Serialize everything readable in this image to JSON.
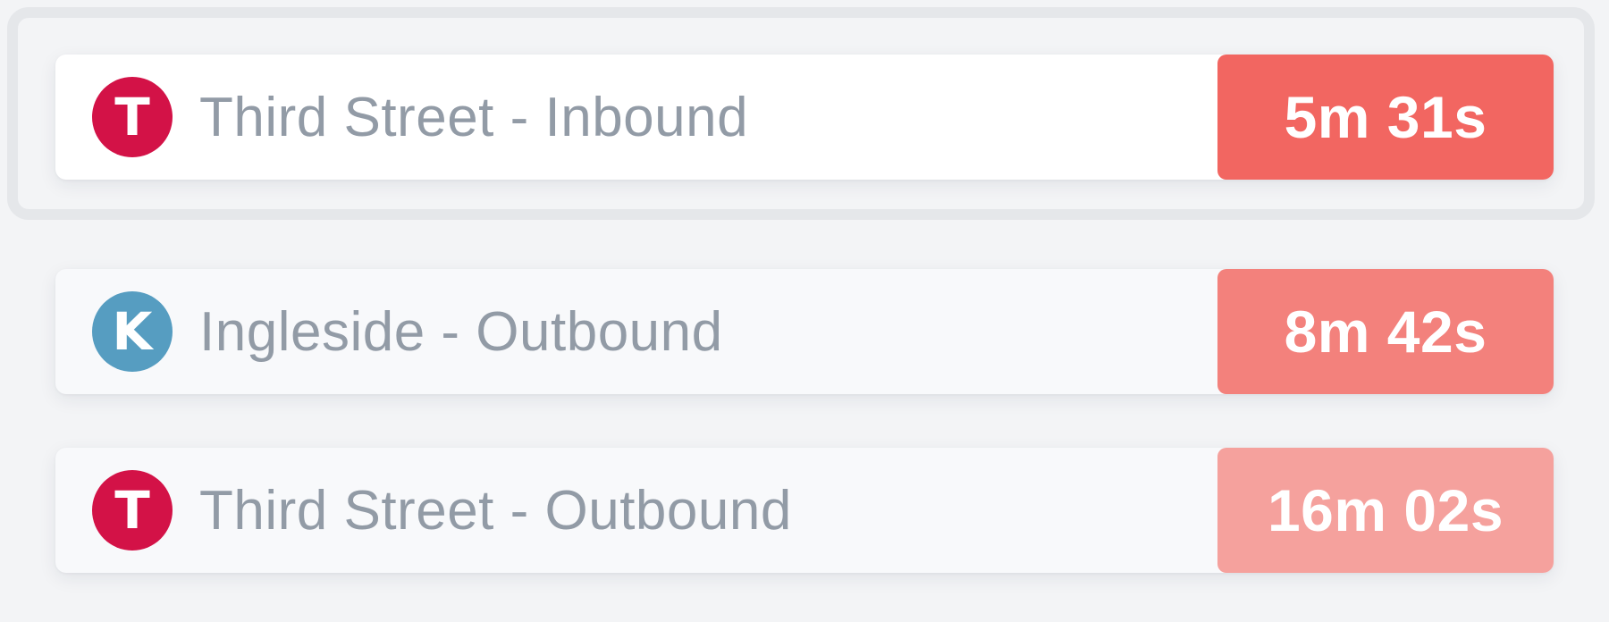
{
  "colors": {
    "line_T": "#d31247",
    "line_K": "#569dc1",
    "eta_1": "#f26661",
    "eta_2": "#f3817c",
    "eta_3": "#f5a19d"
  },
  "departures": [
    {
      "line": "T",
      "route": "Third Street - Inbound",
      "eta": "5m 31s"
    },
    {
      "line": "K",
      "route": "Ingleside - Outbound",
      "eta": "8m 42s"
    },
    {
      "line": "T",
      "route": "Third Street - Outbound",
      "eta": "16m 02s"
    }
  ]
}
